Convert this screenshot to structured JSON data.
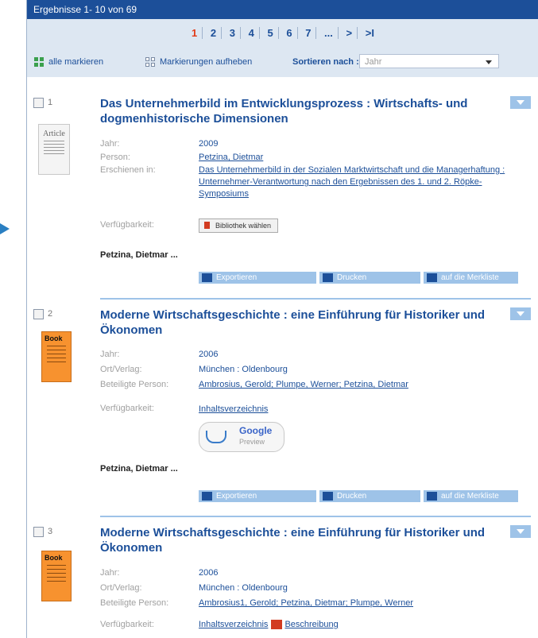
{
  "results_bar": {
    "label": "Ergebnisse 1- 10 von 69"
  },
  "pager": {
    "pages": [
      "1",
      "2",
      "3",
      "4",
      "5",
      "6",
      "7",
      "...",
      ">",
      ">I"
    ],
    "current": "1"
  },
  "actions": {
    "mark_all": "alle markieren",
    "unmark": "Markierungen aufheben",
    "sort_label": "Sortieren nach :",
    "sort_value": "Jahr"
  },
  "records": [
    {
      "num": "1",
      "title": "Das Unternehmerbild im Entwicklungsprozess : Wirtschafts- und dogmenhistorische Dimensionen",
      "thumb": "Article",
      "fields": [
        {
          "label": "Jahr:",
          "value": "2009",
          "link": false
        },
        {
          "label": "Person:",
          "value": "Petzina, Dietmar",
          "link": true
        },
        {
          "label": "Erschienen in:",
          "value": "Das Unternehmerbild in der Sozialen Marktwirtschaft und die Managerhaftung : Unternehmer-Verantwortung nach den Ergebnissen des 1. und 2. Röpke-Symposiums",
          "link": true
        }
      ],
      "availability_label": "Verfügbarkeit:",
      "availability_button": "Bibliothek wählen",
      "author": "Petzina, Dietmar ...",
      "buttons": {
        "export": "Exportieren",
        "print": "Drucken",
        "merk": "auf die Merkliste"
      }
    },
    {
      "num": "2",
      "title": "Moderne Wirtschaftsgeschichte : eine Einführung für Historiker und Ökonomen",
      "thumb": "Book",
      "fields": [
        {
          "label": "Jahr:",
          "value": "2006"
        },
        {
          "label": "Ort/Verlag:",
          "value": "München : Oldenbourg"
        },
        {
          "label": "Beteiligte Person:",
          "value": "Ambrosius, Gerold; Plumpe, Werner; Petzina, Dietmar"
        }
      ],
      "availability_label": "Verfügbarkeit:",
      "availability_link": "Inhaltsverzeichnis",
      "google": {
        "title": "Google",
        "sub": "Preview"
      },
      "author": "Petzina, Dietmar ...",
      "buttons": {
        "export": "Exportieren",
        "print": "Drucken",
        "merk": "auf die Merkliste"
      }
    },
    {
      "num": "3",
      "title": "Moderne Wirtschaftsgeschichte : eine Einführung für Historiker und Ökonomen",
      "thumb": "Book",
      "fields": [
        {
          "label": "Jahr:",
          "value": "2006"
        },
        {
          "label": "Ort/Verlag:",
          "value": "München : Oldenbourg"
        },
        {
          "label": "Beteiligte Person:",
          "value": "Ambrosius1, Gerold; Petzina, Dietmar; Plumpe, Werner"
        }
      ],
      "availability_label": "Verfügbarkeit:",
      "availability_link": "Inhaltsverzeichnis",
      "availability_link2": "Beschreibung"
    }
  ],
  "colors": {
    "brand": "#1c4f99",
    "accent": "#e23b18",
    "button": "#9ec3e8",
    "book": "#f7922f"
  }
}
